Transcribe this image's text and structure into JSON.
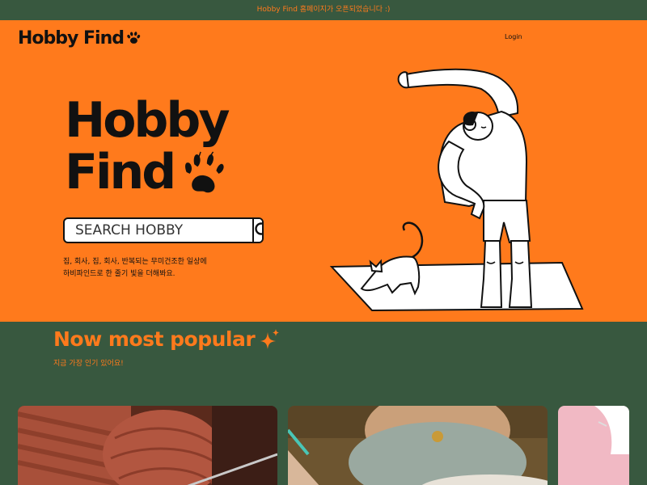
{
  "announcement": "Hobby Find 홈페이지가 오픈되었습니다 :)",
  "nav": {
    "logo_text": "Hobby Find",
    "login_label": "Login"
  },
  "hero": {
    "title_line1": "Hobby",
    "title_line2": "Find",
    "search_placeholder": "SEARCH HOBBY",
    "description_line1": "집, 회사, 집, 회사, 반복되는 무미건조한 일상에",
    "description_line2": "하비파인드로 한 줄기 빛을 더해봐요."
  },
  "popular": {
    "title": "Now most popular",
    "subtitle": "지금 가장 인기 있어요!"
  },
  "colors": {
    "orange": "#ff7a1c",
    "green": "#38583f",
    "black": "#111111"
  },
  "icons": [
    "paw-icon",
    "search-icon",
    "sparkle-icon"
  ]
}
